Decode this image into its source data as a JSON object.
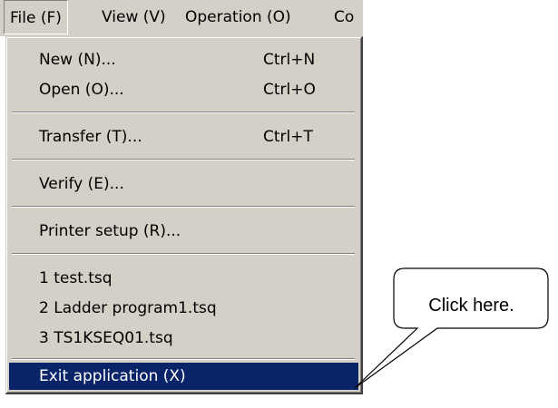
{
  "menubar": {
    "items": [
      {
        "label": "File (F)"
      },
      {
        "label": "View (V)"
      },
      {
        "label": "Operation (O)"
      },
      {
        "label": "Co"
      }
    ]
  },
  "file_menu": {
    "new": {
      "label": "New (N)...",
      "shortcut": "Ctrl+N"
    },
    "open": {
      "label": "Open (O)...",
      "shortcut": "Ctrl+O"
    },
    "transfer": {
      "label": "Transfer (T)...",
      "shortcut": "Ctrl+T"
    },
    "verify": {
      "label": "Verify (E)..."
    },
    "printer_setup": {
      "label": "Printer setup (R)..."
    },
    "recent_files": [
      {
        "label": "1 test.tsq"
      },
      {
        "label": "2 Ladder program1.tsq"
      },
      {
        "label": "3 TS1KSEQ01.tsq"
      }
    ],
    "exit": {
      "label": "Exit application (X)"
    }
  },
  "callout": {
    "text": "Click here."
  },
  "colors": {
    "menu_background": "#d4d0c8",
    "highlight_background": "#0a246a",
    "highlight_text": "#ffffff"
  }
}
